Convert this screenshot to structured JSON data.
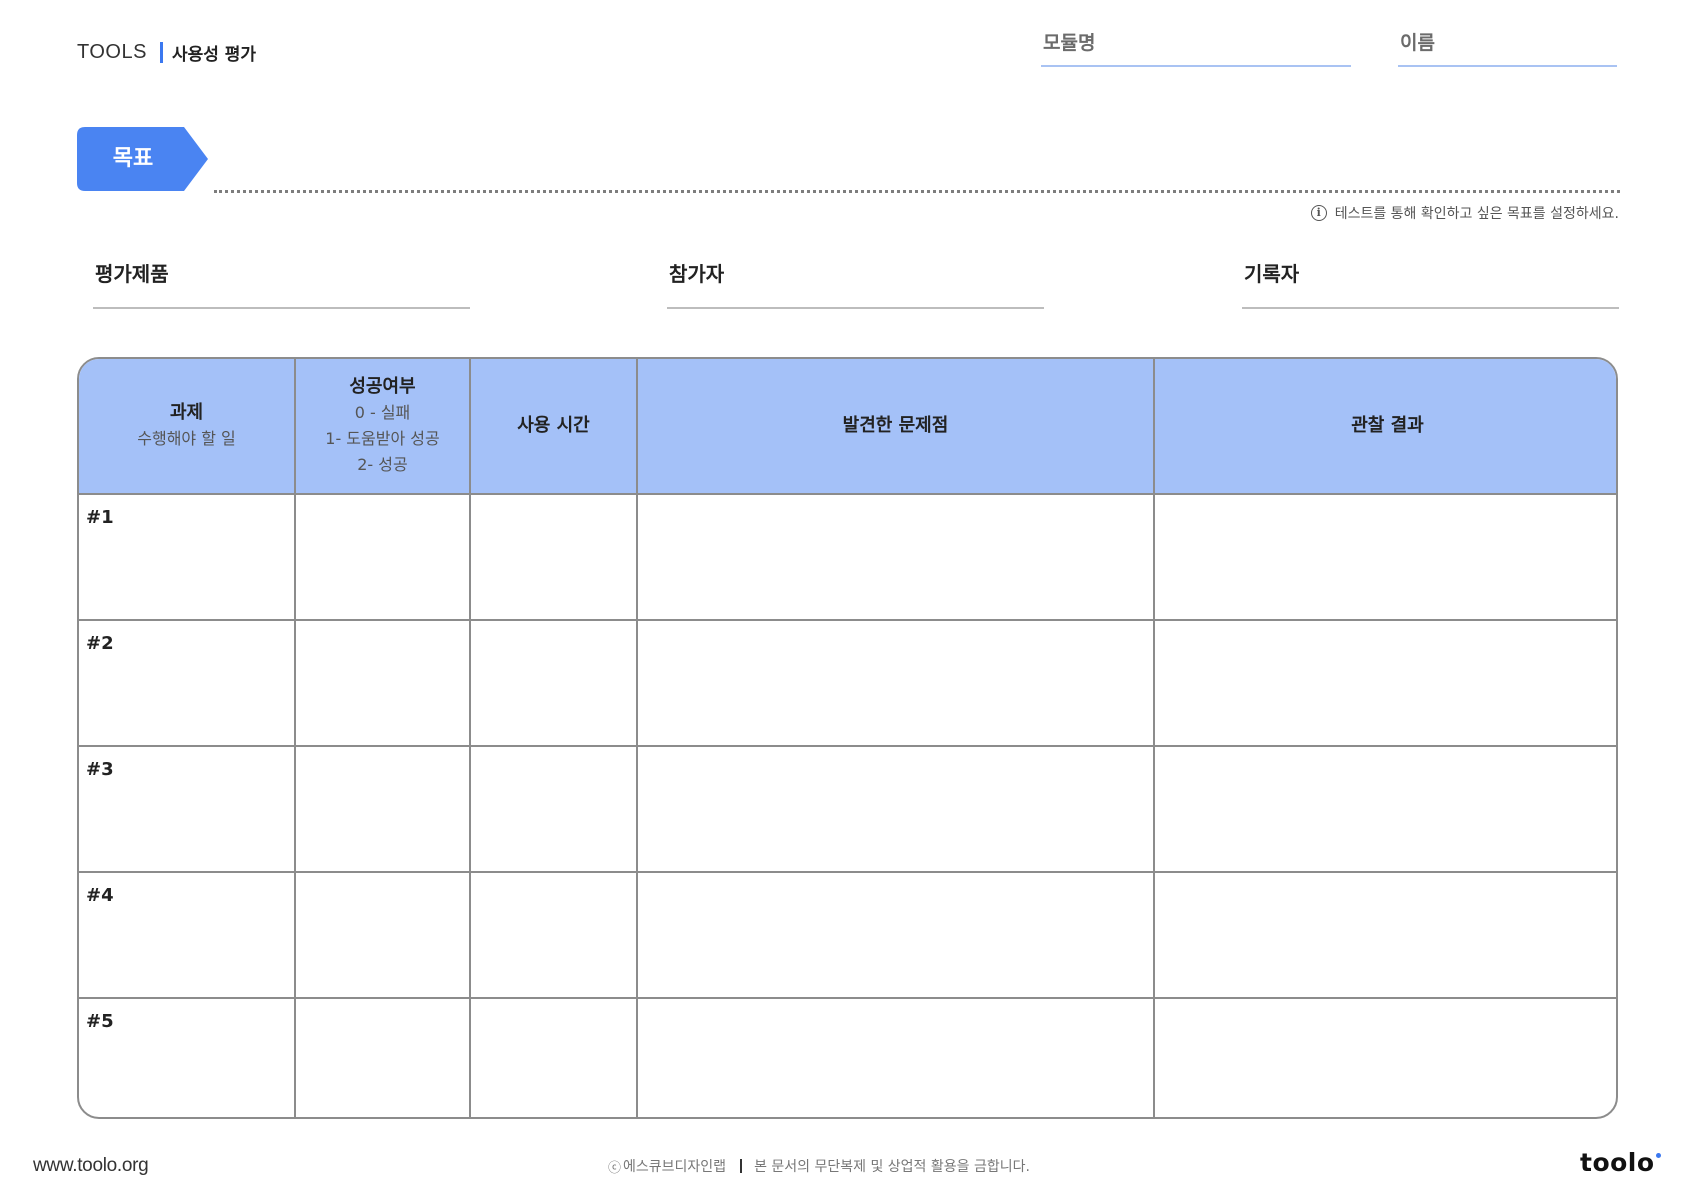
{
  "header": {
    "brand": "TOOLS",
    "subtitle": "사용성 평가",
    "module_label": "모듈명",
    "name_label": "이름"
  },
  "goal": {
    "label": "목표",
    "hint": "테스트를 통해 확인하고 싶은 목표를 설정하세요."
  },
  "fields": {
    "product": "평가제품",
    "participant": "참가자",
    "recorder": "기록자"
  },
  "table": {
    "headers": [
      {
        "title": "과제",
        "sub": [
          "수행해야 할 일"
        ]
      },
      {
        "title": "성공여부",
        "sub": [
          "0 - 실패",
          "1- 도움받아 성공",
          "2- 성공"
        ]
      },
      {
        "title": "사용 시간",
        "sub": []
      },
      {
        "title": "발견한 문제점",
        "sub": []
      },
      {
        "title": "관찰 결과",
        "sub": []
      }
    ],
    "rows": [
      "#1",
      "#2",
      "#3",
      "#4",
      "#5"
    ]
  },
  "footer": {
    "url": "www.toolo.org",
    "copyright_symbol": "ⓒ",
    "copyright": "에스큐브디자인랩",
    "notice": "본 문서의 무단복제 및 상업적 활용을 금합니다.",
    "logo": "toolo"
  },
  "colors": {
    "accent": "#3b78f0",
    "header_fill": "#a4c1f8",
    "goal_tag": "#4a84f2"
  }
}
